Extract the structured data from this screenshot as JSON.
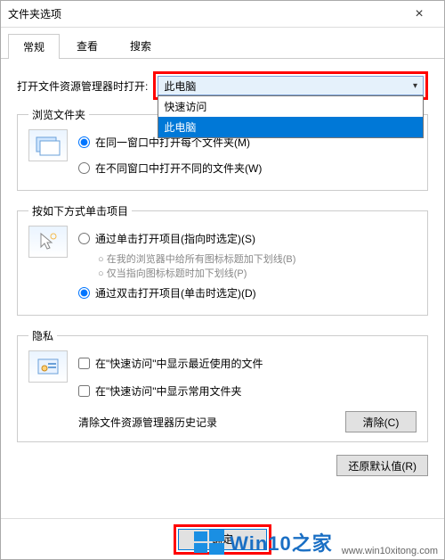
{
  "window": {
    "title": "文件夹选项"
  },
  "tabs": {
    "general": "常规",
    "view": "查看",
    "search": "搜索"
  },
  "row1": {
    "label": "打开文件资源管理器时打开:",
    "selected": "此电脑",
    "opt_quick": "快速访问",
    "opt_pc": "此电脑"
  },
  "browse": {
    "legend": "浏览文件夹",
    "same": "在同一窗口中打开每个文件夹(M)",
    "diff": "在不同窗口中打开不同的文件夹(W)"
  },
  "click": {
    "legend": "按如下方式单击项目",
    "single": "通过单击打开项目(指向时选定)(S)",
    "sub1": "在我的浏览器中给所有图标标题加下划线(B)",
    "sub2": "仅当指向图标标题时加下划线(P)",
    "double": "通过双击打开项目(单击时选定)(D)"
  },
  "privacy": {
    "legend": "隐私",
    "recent": "在\"快速访问\"中显示最近使用的文件",
    "freq": "在\"快速访问\"中显示常用文件夹",
    "clear_label": "清除文件资源管理器历史记录",
    "clear_btn": "清除(C)"
  },
  "restore": "还原默认值(R)",
  "footer": {
    "ok": "确定"
  },
  "watermark": {
    "brand": "Win10",
    "suffix": "之家",
    "url": "www.win10xitong.com"
  }
}
